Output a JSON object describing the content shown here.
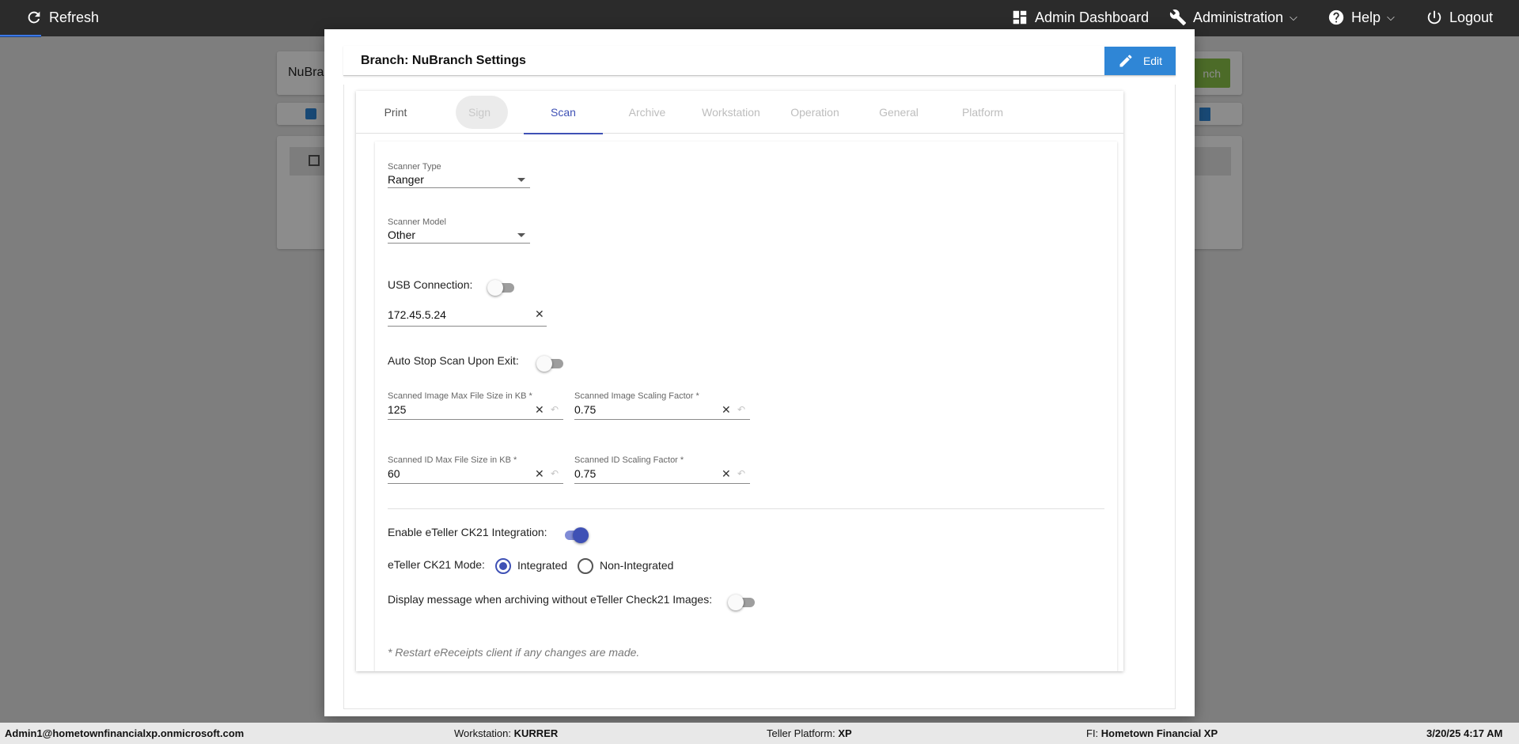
{
  "topbar": {
    "refresh_label": "Refresh",
    "admin_dashboard_label": "Admin Dashboard",
    "administration_label": "Administration",
    "help_label": "Help",
    "logout_label": "Logout"
  },
  "background": {
    "name_field_value": "NuBran",
    "green_button_label": "nch"
  },
  "modal": {
    "title": "Branch: NuBranch Settings",
    "edit_label": "Edit",
    "tabs": [
      {
        "label": "Print"
      },
      {
        "label": "Sign"
      },
      {
        "label": "Scan"
      },
      {
        "label": "Archive"
      },
      {
        "label": "Workstation"
      },
      {
        "label": "Operation"
      },
      {
        "label": "General"
      },
      {
        "label": "Platform"
      }
    ],
    "active_tab": "Scan"
  },
  "scan": {
    "scanner_type": {
      "label": "Scanner Type",
      "value": "Ranger"
    },
    "scanner_model": {
      "label": "Scanner Model",
      "value": "Other"
    },
    "usb_connection": {
      "label": "USB Connection:",
      "on": false
    },
    "ip_address": {
      "value": "172.45.5.24"
    },
    "auto_stop": {
      "label": "Auto Stop Scan Upon Exit:",
      "on": false
    },
    "image_max_size": {
      "label": "Scanned Image Max File Size in KB *",
      "value": "125"
    },
    "image_scaling": {
      "label": "Scanned Image Scaling Factor *",
      "value": "0.75"
    },
    "id_max_size": {
      "label": "Scanned ID Max File Size in KB *",
      "value": "60"
    },
    "id_scaling": {
      "label": "Scanned ID Scaling Factor *",
      "value": "0.75"
    },
    "ck21_integration": {
      "label": "Enable eTeller CK21 Integration:",
      "on": true
    },
    "ck21_mode": {
      "label": "eTeller CK21 Mode:",
      "options": [
        "Integrated",
        "Non-Integrated"
      ],
      "selected": "Integrated"
    },
    "display_message": {
      "label": "Display message when archiving without eTeller Check21 Images:",
      "on": false
    },
    "note": "* Restart eReceipts client if any changes are made."
  },
  "statusbar": {
    "user": "Admin1@hometownfinancialxp.onmicrosoft.com",
    "workstation_label": "Workstation:",
    "workstation_value": "KURRER",
    "platform_label": "Teller Platform:",
    "platform_value": "XP",
    "fi_label": "FI:",
    "fi_value": "Hometown Financial XP",
    "datetime": "3/20/25 4:17 AM"
  },
  "colors": {
    "primary": "#3f51b5",
    "edit_button": "#2f86d6",
    "topbar": "#2b2b2b",
    "green_button": "#8bc34a"
  }
}
